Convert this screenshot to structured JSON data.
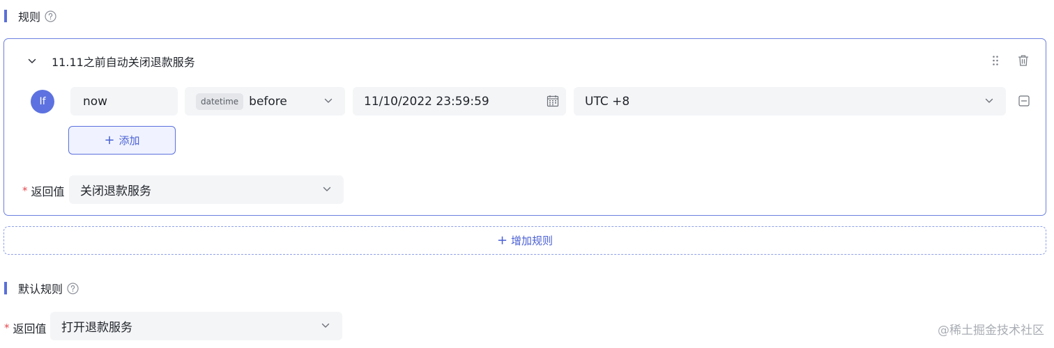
{
  "rules_section": {
    "title": "规则"
  },
  "rule": {
    "name": "11.11之前自动关闭退款服务",
    "if_label": "If",
    "left_value": "now",
    "type_tag": "datetime",
    "operator": "before",
    "date_value": "11/10/2022 23:59:59",
    "timezone": "UTC +8",
    "add_label": "添加",
    "return_label": "返回值",
    "return_value": "关闭退款服务"
  },
  "add_rule_label": "增加规则",
  "default_section": {
    "title": "默认规则",
    "return_label": "返回值",
    "return_value": "打开退款服务"
  },
  "required_mark": "*",
  "watermark": "@稀土掘金技术社区",
  "colors": {
    "accent": "#5a6fd8",
    "required": "#e5484d",
    "field_bg": "#f4f5f7"
  }
}
